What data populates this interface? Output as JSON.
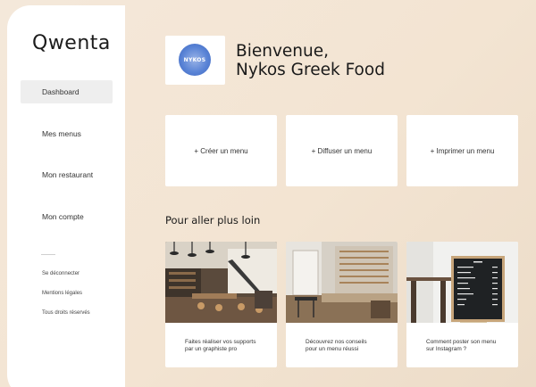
{
  "app": {
    "logo": "Qwenta"
  },
  "sidebar": {
    "items": [
      {
        "label": "Dashboard",
        "active": true
      },
      {
        "label": "Mes menus"
      },
      {
        "label": "Mon restaurant"
      },
      {
        "label": "Mon compte"
      }
    ],
    "links": [
      {
        "label": "Se déconnecter"
      },
      {
        "label": "Mentions légales"
      },
      {
        "label": "Tous droits réservés"
      }
    ]
  },
  "header": {
    "brand_logo_text": "NYKOS",
    "welcome_line1": "Bienvenue,",
    "welcome_line2": "Nykos Greek Food"
  },
  "actions": [
    {
      "label": "+ Créer un menu"
    },
    {
      "label": "+ Diffuser un menu"
    },
    {
      "label": "+ Imprimer un menu"
    }
  ],
  "section": {
    "title": "Pour aller plus loin"
  },
  "tips": [
    {
      "text": "Faites réaliser vos supports par un graphiste pro",
      "image": "cafe-interior-photo"
    },
    {
      "text": "Découvrez nos conseils pour un menu réussi",
      "image": "cafe-counter-photo"
    },
    {
      "text": "Comment poster son menu sur Instagram ?",
      "image": "chalkboard-menu-photo"
    }
  ],
  "colors": {
    "background": "#f3e4d2",
    "card": "#ffffff",
    "brand_blue": "#5a84d6"
  }
}
